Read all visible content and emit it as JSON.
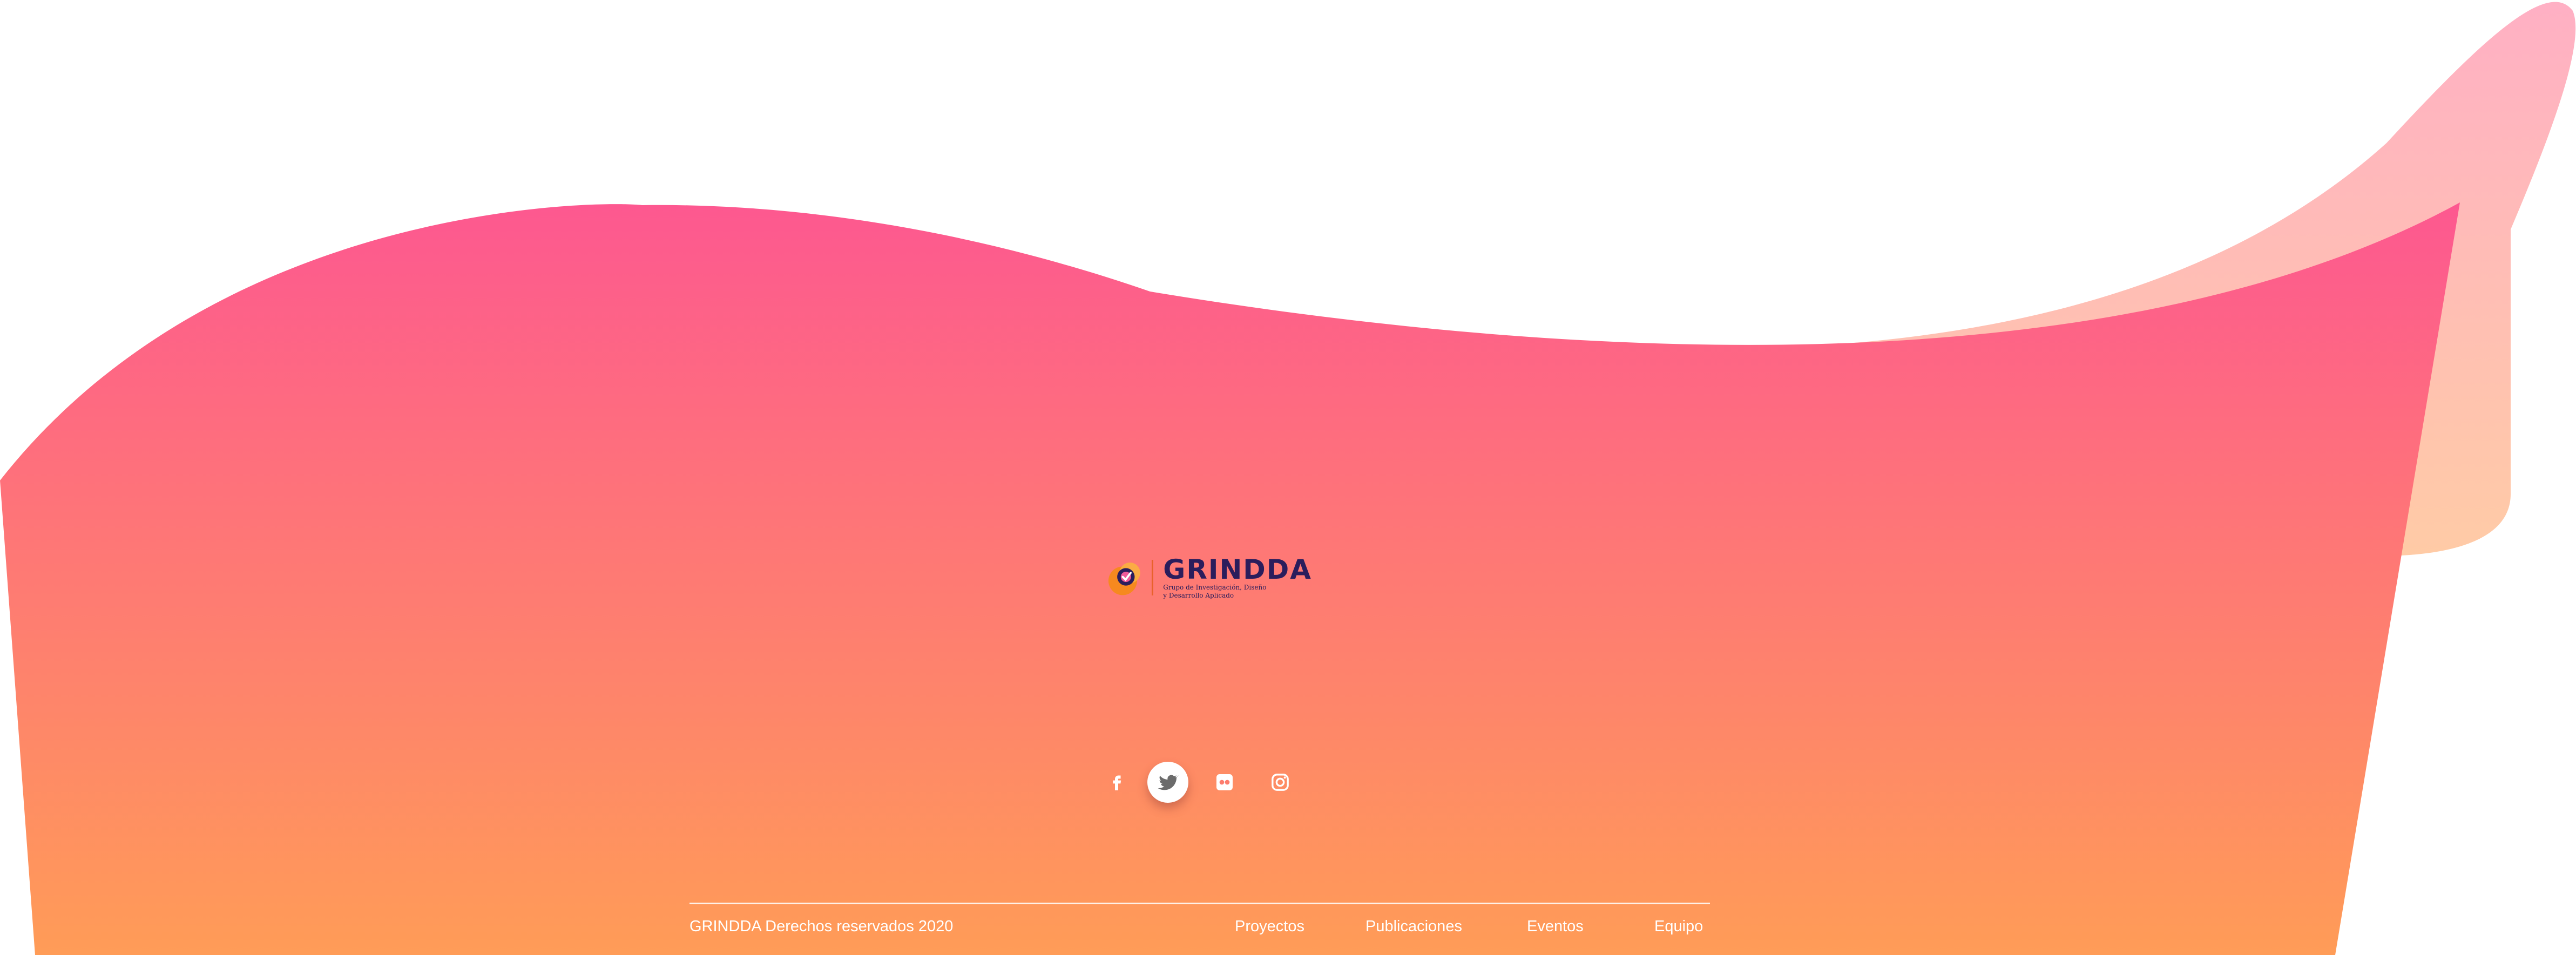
{
  "colors": {
    "wave_top": "#fd5890",
    "wave_bottom": "#ff9c57",
    "back_wave_top": "#ffb0c4",
    "back_wave_bottom": "#ffcba6",
    "text": "#ffffff",
    "logo_text": "#2b1d5c",
    "logo_accent": "#e8622b"
  },
  "logo": {
    "name": "GRINDDA",
    "subtitle_line1": "Grupo de Investigación, Diseño",
    "subtitle_line2": "y Desarrollo Aplicado"
  },
  "social": [
    {
      "name": "facebook",
      "icon": "facebook-icon",
      "active": false
    },
    {
      "name": "twitter",
      "icon": "twitter-icon",
      "active": true
    },
    {
      "name": "flickr",
      "icon": "flickr-icon",
      "active": false
    },
    {
      "name": "instagram",
      "icon": "instagram-icon",
      "active": false
    }
  ],
  "footer": {
    "copyright": "GRINDDA Derechos reservados 2020",
    "nav": [
      "Proyectos",
      "Publicaciones",
      "Eventos",
      "Equipo"
    ]
  }
}
